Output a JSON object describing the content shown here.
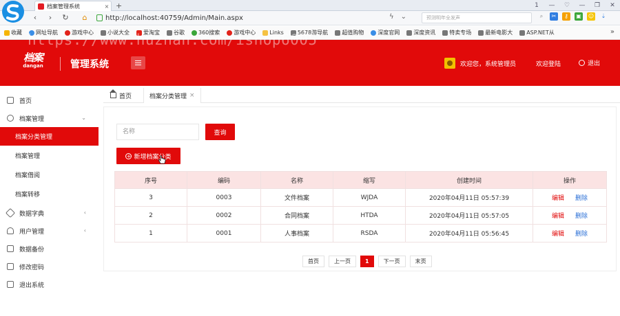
{
  "browser": {
    "tab_title": "档案管理系统",
    "tab_close": "×",
    "new_tab": "+",
    "url": "http://localhost:40759/Admin/Main.aspx",
    "search_placeholder": "预测明年全发声",
    "window_controls": [
      "1",
      "—",
      "♡",
      "—",
      "❐",
      "✕"
    ]
  },
  "bookmarks": [
    {
      "label": "收藏",
      "color": "#f5b400"
    },
    {
      "label": "网址导航",
      "color": "#3a8ee6"
    },
    {
      "label": "游戏中心",
      "color": "#e2231a"
    },
    {
      "label": "小说大全",
      "color": "#777777"
    },
    {
      "label": "爱淘宝",
      "color": "#e2231a"
    },
    {
      "label": "谷歌",
      "color": "#777777"
    },
    {
      "label": "360搜索",
      "color": "#3aa63a"
    },
    {
      "label": "游戏中心",
      "color": "#e2231a"
    },
    {
      "label": "Links",
      "color": "#f5c242"
    },
    {
      "label": "5678游导航",
      "color": "#777777"
    },
    {
      "label": "超值购物",
      "color": "#777777"
    },
    {
      "label": "深度官网",
      "color": "#3a8ee6"
    },
    {
      "label": "深度资讯",
      "color": "#777777"
    },
    {
      "label": "特卖专场",
      "color": "#777777"
    },
    {
      "label": "最新电影大",
      "color": "#777777"
    },
    {
      "label": "ASP.NET从",
      "color": "#777777"
    }
  ],
  "bookmarks_more": "»",
  "watermark": "https://www.huzhan.com/ishop6005",
  "header": {
    "logo_cn": "档案",
    "logo_en": "dangan",
    "app_name": "管理系统",
    "welcome": "欢迎您，系统管理员",
    "login_link": "欢迎登陆",
    "logout": "退出",
    "accent": "#e10a0a"
  },
  "sidebar": {
    "items": [
      {
        "label": "首页",
        "icon": "monitor-icon"
      },
      {
        "label": "档案管理",
        "icon": "key-icon",
        "chevron": "⌄"
      },
      {
        "label": "档案分类管理",
        "active": true
      },
      {
        "label": "档案管理"
      },
      {
        "label": "档案借阅"
      },
      {
        "label": "档案转移"
      },
      {
        "label": "数据字典",
        "icon": "tag-icon",
        "chevron": "‹"
      },
      {
        "label": "用户管理",
        "icon": "users-icon",
        "chevron": "‹"
      },
      {
        "label": "数据备份",
        "icon": "clipboard-icon"
      },
      {
        "label": "修改密码",
        "icon": "book-icon"
      },
      {
        "label": "退出系统",
        "icon": "screen-icon"
      }
    ]
  },
  "page_tabs": [
    {
      "label": "首页"
    },
    {
      "label": "档案分类管理",
      "close": "×"
    }
  ],
  "search": {
    "placeholder": "名称",
    "query_label": "查询",
    "add_label": "新增档案分类"
  },
  "table": {
    "headers": [
      "序号",
      "编码",
      "名称",
      "缩写",
      "创建时间",
      "操作"
    ],
    "edit_label": "编辑",
    "delete_label": "删除",
    "rows": [
      [
        "3",
        "0003",
        "文件档案",
        "WJDA",
        "2020年04月11日 05:57:39"
      ],
      [
        "2",
        "0002",
        "合同档案",
        "HTDA",
        "2020年04月11日 05:57:05"
      ],
      [
        "1",
        "0001",
        "人事档案",
        "RSDA",
        "2020年04月11日 05:56:45"
      ]
    ]
  },
  "pager": {
    "first": "首页",
    "prev": "上一页",
    "current": "1",
    "next": "下一页",
    "last": "末页"
  }
}
